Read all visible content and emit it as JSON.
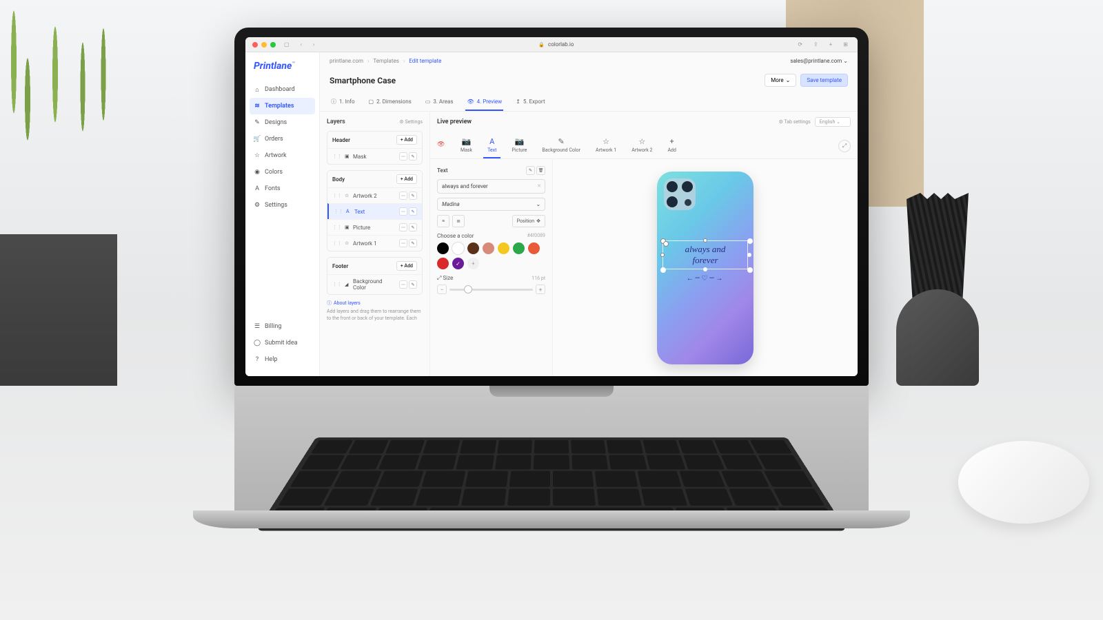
{
  "browser": {
    "url": "colorlab.io"
  },
  "brand": "Printlane",
  "account_email": "sales@printlane.com",
  "sidebar": {
    "primary": [
      {
        "icon": "⌂",
        "label": "Dashboard"
      },
      {
        "icon": "≋",
        "label": "Templates",
        "active": true
      },
      {
        "icon": "✎",
        "label": "Designs"
      },
      {
        "icon": "🛒",
        "label": "Orders"
      },
      {
        "icon": "☆",
        "label": "Artwork"
      },
      {
        "icon": "◉",
        "label": "Colors"
      },
      {
        "icon": "A",
        "label": "Fonts"
      },
      {
        "icon": "⚙",
        "label": "Settings"
      }
    ],
    "secondary": [
      {
        "icon": "☰",
        "label": "Billing"
      },
      {
        "icon": "◯",
        "label": "Submit idea"
      },
      {
        "icon": "?",
        "label": "Help"
      }
    ]
  },
  "breadcrumbs": [
    "printlane.com",
    "Templates",
    "Edit template"
  ],
  "page": {
    "title": "Smartphone Case",
    "more_label": "More",
    "save_label": "Save template"
  },
  "tabs": [
    {
      "icon": "ⓘ",
      "label": "1. Info"
    },
    {
      "icon": "▢",
      "label": "2. Dimensions"
    },
    {
      "icon": "▭",
      "label": "3. Areas"
    },
    {
      "icon": "👁",
      "label": "4. Preview",
      "active": true
    },
    {
      "icon": "↥",
      "label": "5. Export"
    }
  ],
  "layers": {
    "title": "Layers",
    "settings_label": "Settings",
    "add_label": "+ Add",
    "groups": [
      {
        "name": "Header",
        "items": [
          {
            "icon": "▣",
            "label": "Mask"
          }
        ]
      },
      {
        "name": "Body",
        "items": [
          {
            "icon": "☆",
            "label": "Artwork 2"
          },
          {
            "icon": "A",
            "label": "Text",
            "selected": true
          },
          {
            "icon": "▣",
            "label": "Picture"
          },
          {
            "icon": "☆",
            "label": "Artwork 1"
          }
        ]
      },
      {
        "name": "Footer",
        "items": [
          {
            "icon": "◢",
            "label": "Background Color"
          }
        ]
      }
    ],
    "about_title": "About layers",
    "about_text": "Add layers and drag them to rearrange them to the front or back of your template. Each"
  },
  "editor": {
    "title": "Live preview",
    "tab_settings_label": "Tab settings",
    "language": "English",
    "tool_tabs": [
      {
        "icon": "📷",
        "label": "Mask"
      },
      {
        "icon": "A",
        "label": "Text",
        "active": true
      },
      {
        "icon": "📷",
        "label": "Picture"
      },
      {
        "icon": "✎",
        "label": "Background Color"
      },
      {
        "icon": "☆",
        "label": "Artwork 1"
      },
      {
        "icon": "☆",
        "label": "Artwork 2"
      },
      {
        "icon": "+",
        "label": "Add"
      }
    ],
    "text_panel": {
      "title": "Text",
      "value": "always and forever",
      "font": "Madina",
      "position_label": "Position",
      "color_label": "Choose a color",
      "color_hex": "#4f0089",
      "swatches": [
        "#000000",
        "#ffffff",
        "#5a3018",
        "#d88a7a",
        "#f4c820",
        "#2aa84a",
        "#e85a3a",
        "#d82a2a",
        "#6a1b9a"
      ],
      "selected_swatch": 8,
      "size_label": "Size",
      "size_value": "116 pt"
    },
    "preview_text": "always and\nforever"
  }
}
